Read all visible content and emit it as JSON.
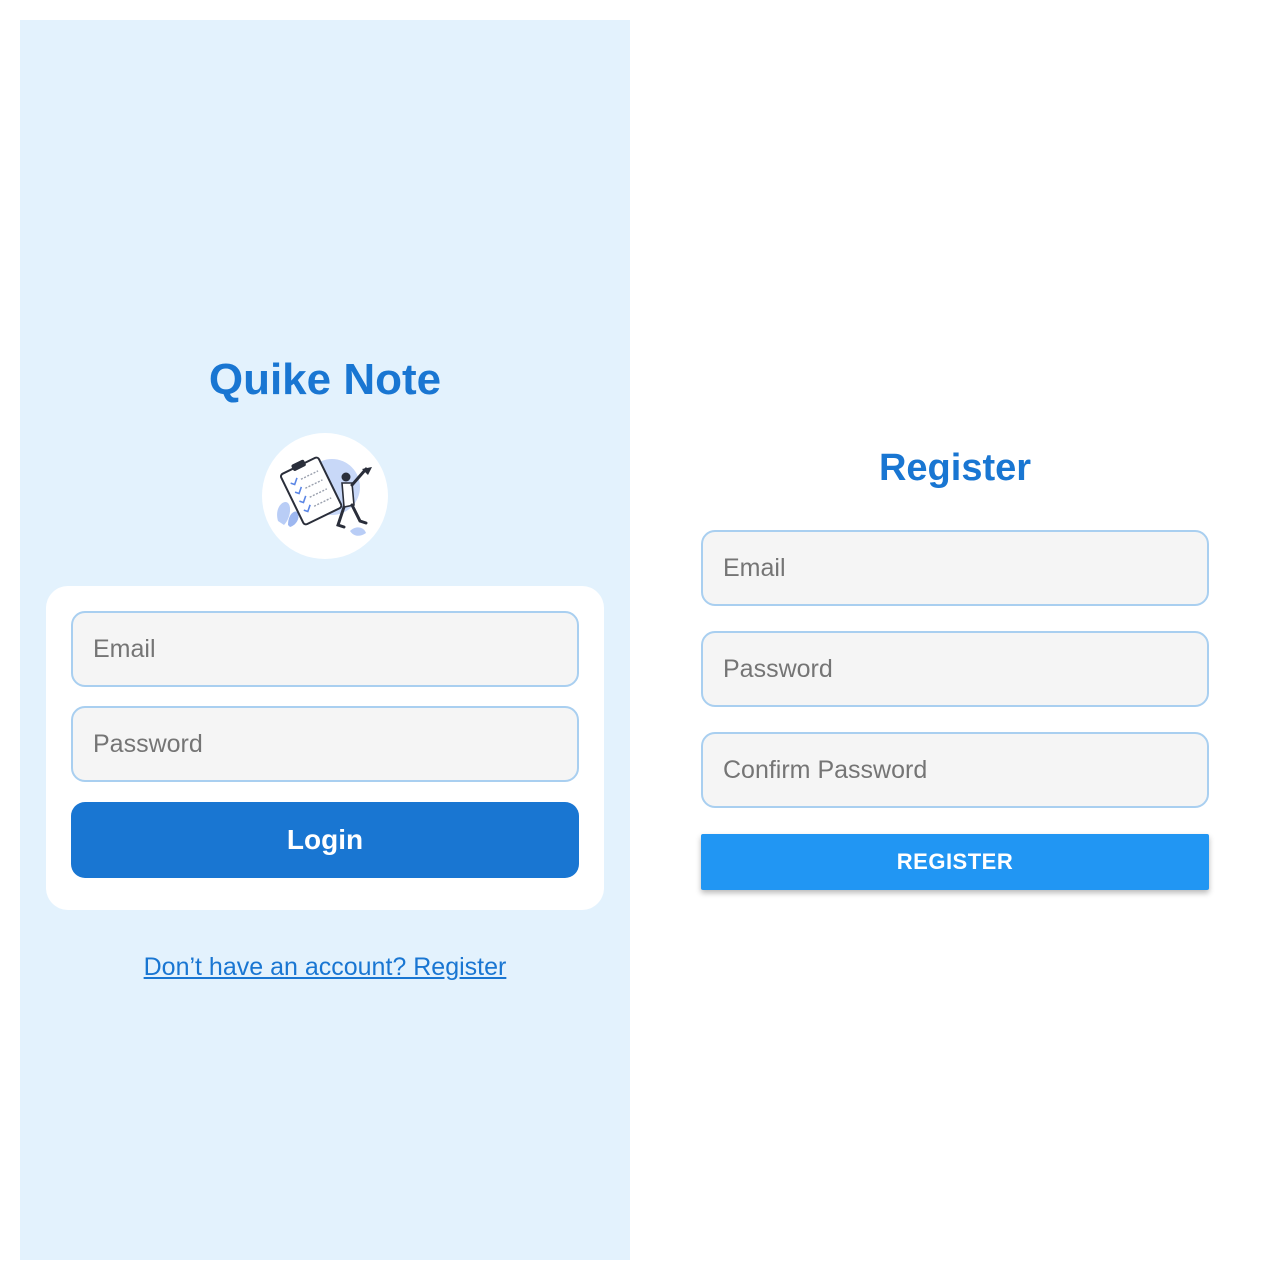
{
  "colors": {
    "primary": "#1976d2",
    "register_button": "#2196f3",
    "login_background": "#e3f2fd",
    "field_background": "#f5f5f5",
    "field_border": "#a9cff0"
  },
  "login": {
    "app_title": "Quike Note",
    "logo_icon": "notes-checklist-illustration-icon",
    "email_placeholder": "Email",
    "password_placeholder": "Password",
    "login_button": "Login",
    "register_link": "Don’t have an account? Register"
  },
  "register": {
    "title": "Register",
    "email_placeholder": "Email",
    "password_placeholder": "Password",
    "confirm_password_placeholder": "Confirm Password",
    "register_button": "REGISTER"
  }
}
